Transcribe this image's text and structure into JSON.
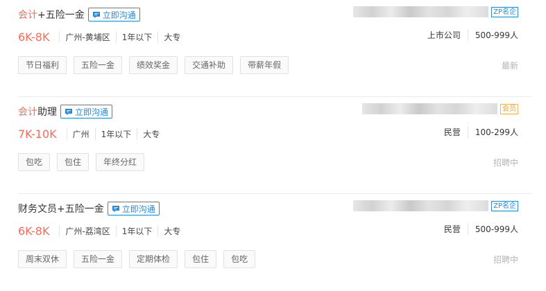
{
  "colors": {
    "accent": "#f26d5b",
    "link": "#2a88d8",
    "vip": "#e8a23a"
  },
  "icons": {
    "chat": "chat-bubble-icon"
  },
  "jobs": [
    {
      "title_kw": "会计",
      "title_rest": "+五险一金",
      "chat_label": "立即沟通",
      "salary": "6K-8K",
      "location": "广州-黄埔区",
      "experience": "1年以下",
      "education": "大专",
      "tags": [
        "节日福利",
        "五险一金",
        "绩效奖金",
        "交通补助",
        "带薪年假"
      ],
      "badge": "ZP名企",
      "company_type": "上市公司",
      "company_size": "500-999人",
      "status": "最新"
    },
    {
      "title_kw": "会计",
      "title_rest": "助理",
      "chat_label": "立即沟通",
      "salary": "7K-10K",
      "location": "广州",
      "experience": "1年以下",
      "education": "大专",
      "tags": [
        "包吃",
        "包住",
        "年终分红"
      ],
      "badge": "会员",
      "company_type": "民营",
      "company_size": "100-299人",
      "status": "招聘中"
    },
    {
      "title_kw": "",
      "title_rest": "财务文员+五险一金",
      "chat_label": "立即沟通",
      "salary": "6K-8K",
      "location": "广州-荔湾区",
      "experience": "1年以下",
      "education": "大专",
      "tags": [
        "周末双休",
        "五险一金",
        "定期体检",
        "包住",
        "包吃"
      ],
      "badge": "ZP名企",
      "company_type": "民营",
      "company_size": "500-999人",
      "status": "招聘中"
    }
  ]
}
